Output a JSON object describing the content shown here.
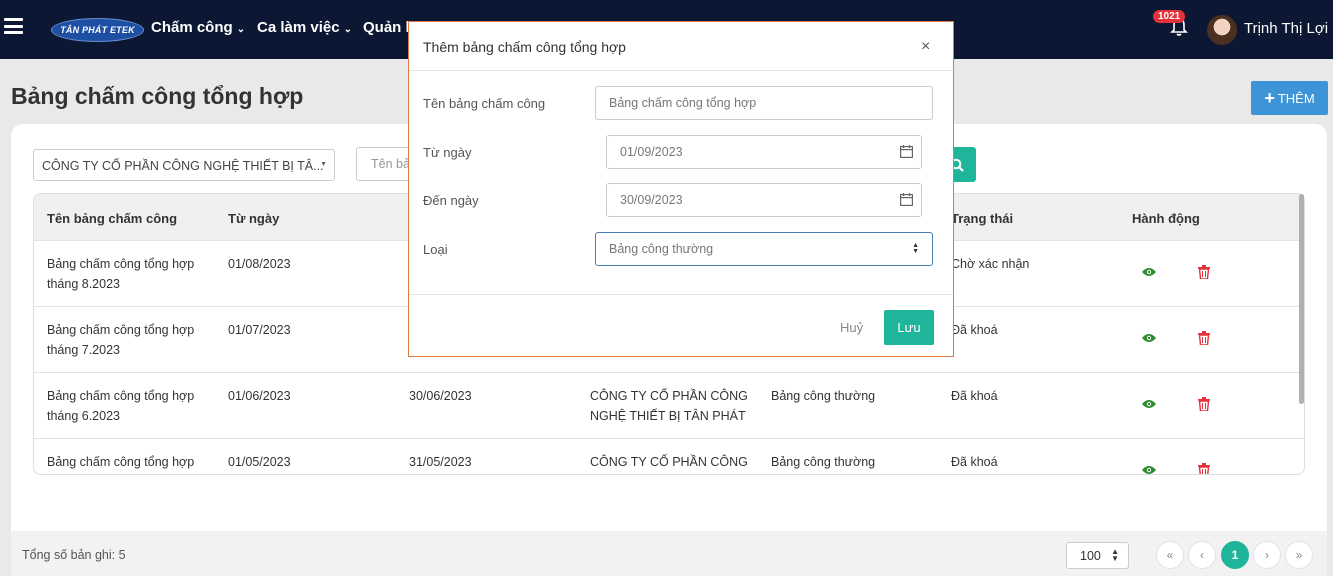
{
  "nav": {
    "logo": "TÂN PHÁT ETEK",
    "menu": [
      {
        "label": "Chấm công"
      },
      {
        "label": "Ca làm việc"
      },
      {
        "label": "Quản lý"
      }
    ],
    "notification_count": "1021",
    "user_name": "Trịnh Thị Lợi"
  },
  "page": {
    "title": "Bảng chấm công tổng hợp",
    "add_button": "THÊM",
    "company_filter": "CÔNG TY CỔ PHẦN CÔNG NGHỆ THIẾT BỊ TÂ...",
    "search_placeholder": "Tên bả"
  },
  "table": {
    "headers": [
      "Tên bảng chấm công",
      "Từ ngày",
      "Trạng thái",
      "Hành động"
    ],
    "rows": [
      {
        "name_line1": "Bảng chấm công tổng hợp",
        "name_line2": "tháng 8.2023",
        "from": "01/08/2023",
        "to": "",
        "company_line1": "",
        "company_line2": "",
        "type": "",
        "status": "Chờ xác nhận"
      },
      {
        "name_line1": "Bảng chấm công tổng hợp",
        "name_line2": "tháng 7.2023",
        "from": "01/07/2023",
        "to": "",
        "company_line1": "",
        "company_line2": "",
        "type": "",
        "status": "Đã khoá"
      },
      {
        "name_line1": "Bảng chấm công tổng hợp",
        "name_line2": "tháng 6.2023",
        "from": "01/06/2023",
        "to": "30/06/2023",
        "company_line1": "CÔNG TY CỔ PHẦN CÔNG",
        "company_line2": "NGHỆ THIẾT BỊ TÂN PHÁT",
        "type": "Bảng công thường",
        "status": "Đã khoá"
      },
      {
        "name_line1": "Bảng chấm công tổng hợp",
        "name_line2": "",
        "from": "01/05/2023",
        "to": "31/05/2023",
        "company_line1": "CÔNG TY CỔ PHẦN CÔNG",
        "company_line2": "",
        "type": "Bảng công thường",
        "status": "Đã khoá"
      }
    ]
  },
  "footer": {
    "total": "Tổng số bản ghi: 5",
    "page_size": "100",
    "pager": {
      "first": "«",
      "prev": "‹",
      "current": "1",
      "next": "›",
      "last": "»"
    }
  },
  "modal": {
    "title": "Thêm bảng chấm công tổng hợp",
    "close": "×",
    "fields": {
      "name_label": "Tên bảng chấm công",
      "name_placeholder": "Bảng chấm công tổng hợp",
      "from_label": "Từ ngày",
      "from_value": "01/09/2023",
      "to_label": "Đến ngày",
      "to_value": "30/09/2023",
      "type_label": "Loại",
      "type_value": "Bảng công thường"
    },
    "cancel": "Huỷ",
    "save": "Lưu"
  },
  "colors": {
    "navbar": "#0c1733",
    "accent": "#1fb59a",
    "add_button": "#3d95d8",
    "delete": "#e5313a",
    "view": "#2e8b2e"
  }
}
